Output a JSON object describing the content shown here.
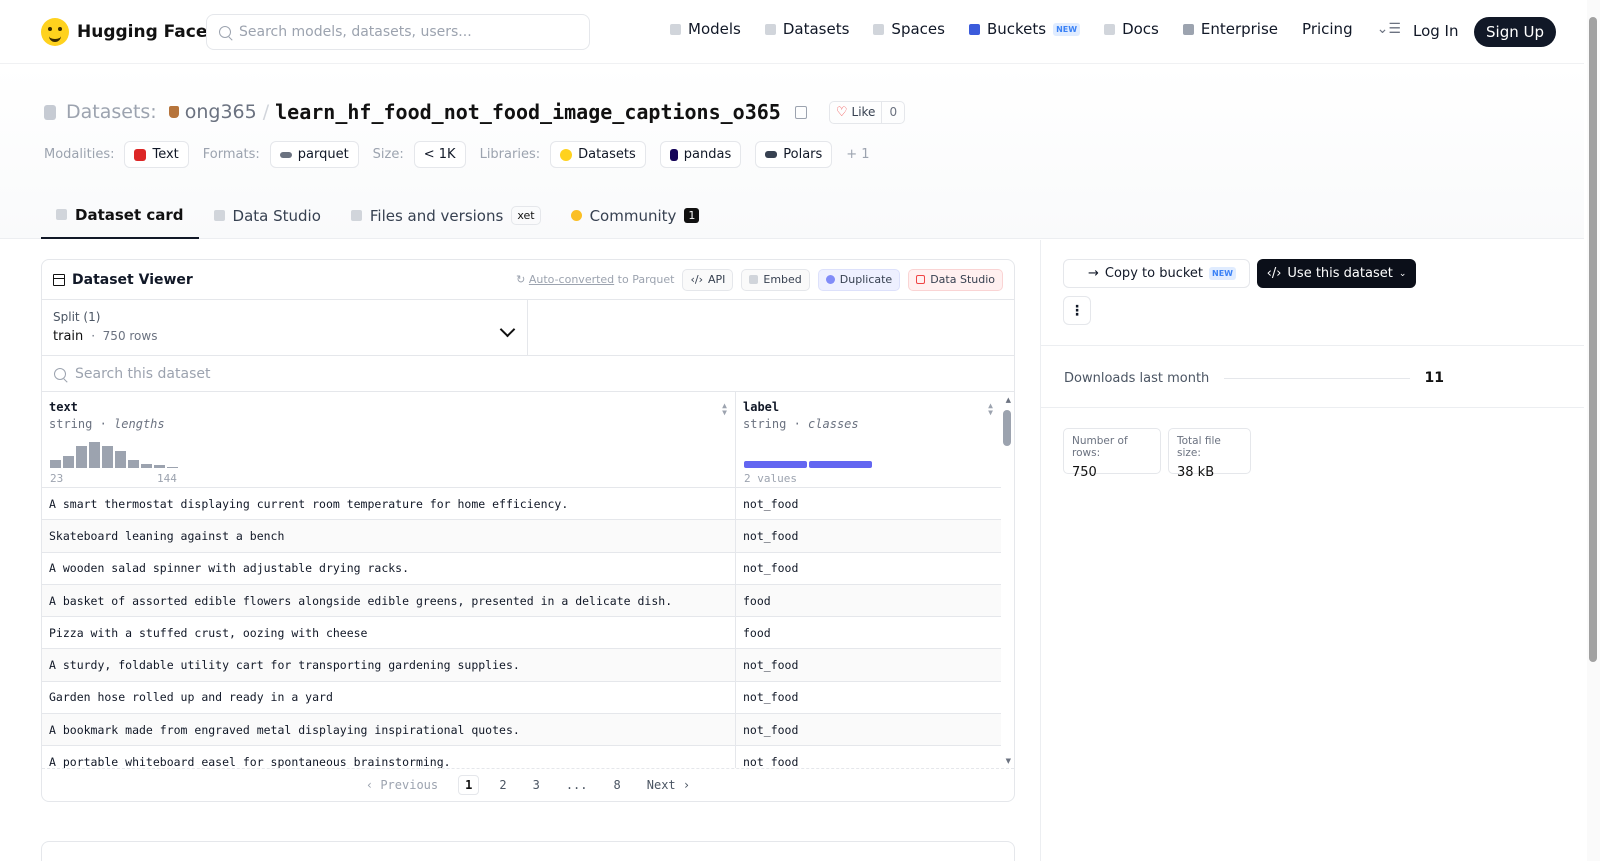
{
  "nav": {
    "brand": "Hugging Face",
    "search_placeholder": "Search models, datasets, users...",
    "links": [
      {
        "label": "Models",
        "icon": "cube-icon"
      },
      {
        "label": "Datasets",
        "icon": "database-icon"
      },
      {
        "label": "Spaces",
        "icon": "grid-icon"
      },
      {
        "label": "Buckets",
        "icon": "bucket-icon",
        "badge": "NEW"
      },
      {
        "label": "Docs",
        "icon": "book-icon"
      },
      {
        "label": "Enterprise",
        "icon": "enterprise-icon"
      },
      {
        "label": "Pricing"
      }
    ],
    "login": "Log In",
    "signup": "Sign Up"
  },
  "repo": {
    "section": "Datasets:",
    "owner": "ong365",
    "separator": "/",
    "name": "learn_hf_food_not_food_image_captions_o365",
    "like_label": "Like",
    "like_count": "0"
  },
  "meta": {
    "modalities_label": "Modalities:",
    "modalities": [
      "Text"
    ],
    "formats_label": "Formats:",
    "formats": [
      "parquet"
    ],
    "size_label": "Size:",
    "size": "< 1K",
    "libraries_label": "Libraries:",
    "libraries": [
      "Datasets",
      "pandas",
      "Polars"
    ],
    "more": "+ 1"
  },
  "tabs": [
    {
      "label": "Dataset card",
      "active": true
    },
    {
      "label": "Data Studio"
    },
    {
      "label": "Files and versions",
      "badge": "xet"
    },
    {
      "label": "Community",
      "count": "1"
    }
  ],
  "viewer": {
    "title": "Dataset Viewer",
    "auto_converted": "Auto-converted",
    "to_parquet": "to Parquet",
    "actions": [
      "API",
      "Embed",
      "Duplicate",
      "Data Studio"
    ],
    "split_label": "Split (1)",
    "split_value": "train",
    "split_rows": "750 rows",
    "search_placeholder": "Search this dataset",
    "columns": [
      {
        "name": "text",
        "type": "string",
        "stat": "lengths",
        "min": "23",
        "max": "144",
        "histogram": [
          0.3,
          0.45,
          0.85,
          1.0,
          0.85,
          0.65,
          0.3,
          0.15,
          0.1,
          0.05
        ]
      },
      {
        "name": "label",
        "type": "string",
        "stat": "classes",
        "values_note": "2 values",
        "class_shares": [
          0.5,
          0.5
        ]
      }
    ],
    "rows": [
      [
        "A smart thermostat displaying current room temperature for home efficiency.",
        "not_food"
      ],
      [
        "Skateboard leaning against a bench",
        "not_food"
      ],
      [
        "A wooden salad spinner with adjustable drying racks.",
        "not_food"
      ],
      [
        "A basket of assorted edible flowers alongside edible greens, presented in a delicate dish.",
        "food"
      ],
      [
        "Pizza with a stuffed crust, oozing with cheese",
        "food"
      ],
      [
        "A sturdy, foldable utility cart for transporting gardening supplies.",
        "not_food"
      ],
      [
        "Garden hose rolled up and ready in a yard",
        "not_food"
      ],
      [
        "A bookmark made from engraved metal displaying inspirational quotes.",
        "not_food"
      ],
      [
        "A portable whiteboard easel for spontaneous brainstorming.",
        "not_food"
      ]
    ],
    "pager": {
      "prev": "Previous",
      "pages": [
        "1",
        "2",
        "3",
        "...",
        "8"
      ],
      "current": "1",
      "next": "Next"
    }
  },
  "sidebar": {
    "copy_bucket": "Copy to bucket",
    "copy_badge": "NEW",
    "use_dataset": "Use this dataset",
    "downloads_label": "Downloads last month",
    "downloads": "11",
    "stats": [
      {
        "label": "Number of rows:",
        "value": "750"
      },
      {
        "label": "Total file size:",
        "value": "38 kB"
      }
    ]
  },
  "colors": {
    "accent_indigo": "#6366f1",
    "dark": "#111827",
    "hf_yellow": "#FFD21E"
  }
}
